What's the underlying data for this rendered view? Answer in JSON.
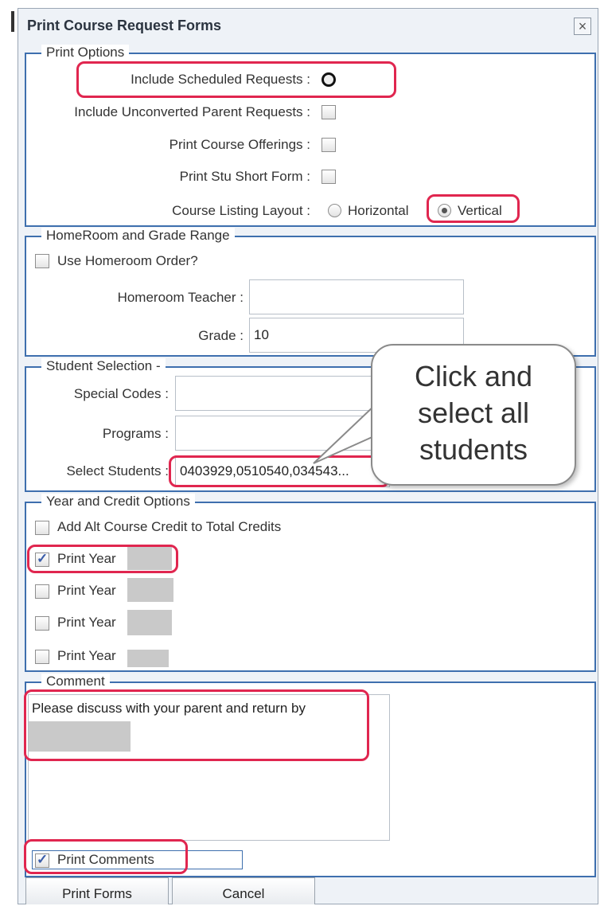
{
  "dialog": {
    "title": "Print Course Request Forms",
    "close_glyph": "×"
  },
  "print_options": {
    "legend": "Print Options",
    "include_scheduled": "Include Scheduled Requests :",
    "include_unconverted": "Include Unconverted Parent Requests :",
    "print_course_offerings": "Print Course Offerings :",
    "print_stu_short": "Print Stu Short Form :",
    "course_listing_layout": "Course Listing Layout :",
    "horizontal": "Horizontal",
    "vertical": "Vertical"
  },
  "homeroom": {
    "legend": "HomeRoom and Grade Range",
    "use_homeroom": "Use Homeroom Order?",
    "homeroom_teacher": "Homeroom Teacher :",
    "homeroom_teacher_value": "",
    "grade": "Grade :",
    "grade_value": "10"
  },
  "student_selection": {
    "legend": "Student Selection -",
    "special_codes": "Special Codes :",
    "programs": "Programs :",
    "select_students": "Select Students :",
    "select_students_value": "0403929,0510540,034543..."
  },
  "year_credit": {
    "legend": "Year and Credit Options",
    "add_alt": "Add Alt Course Credit to Total Credits",
    "print_year_1": "Print Year",
    "print_year_2": "Print Year",
    "print_year_3": "Print Year",
    "print_year_4": "Print Year"
  },
  "comment": {
    "legend": "Comment",
    "text": "Please discuss with your parent and return by",
    "print_comments": "Print Comments"
  },
  "buttons": {
    "print_forms": "Print Forms",
    "cancel": "Cancel"
  },
  "callout": {
    "line1": "Click and",
    "line2": "select all",
    "line3": "students"
  },
  "colors": {
    "highlight": "#e0264f",
    "group_border": "#3e6fae",
    "check": "#3b5da8"
  }
}
